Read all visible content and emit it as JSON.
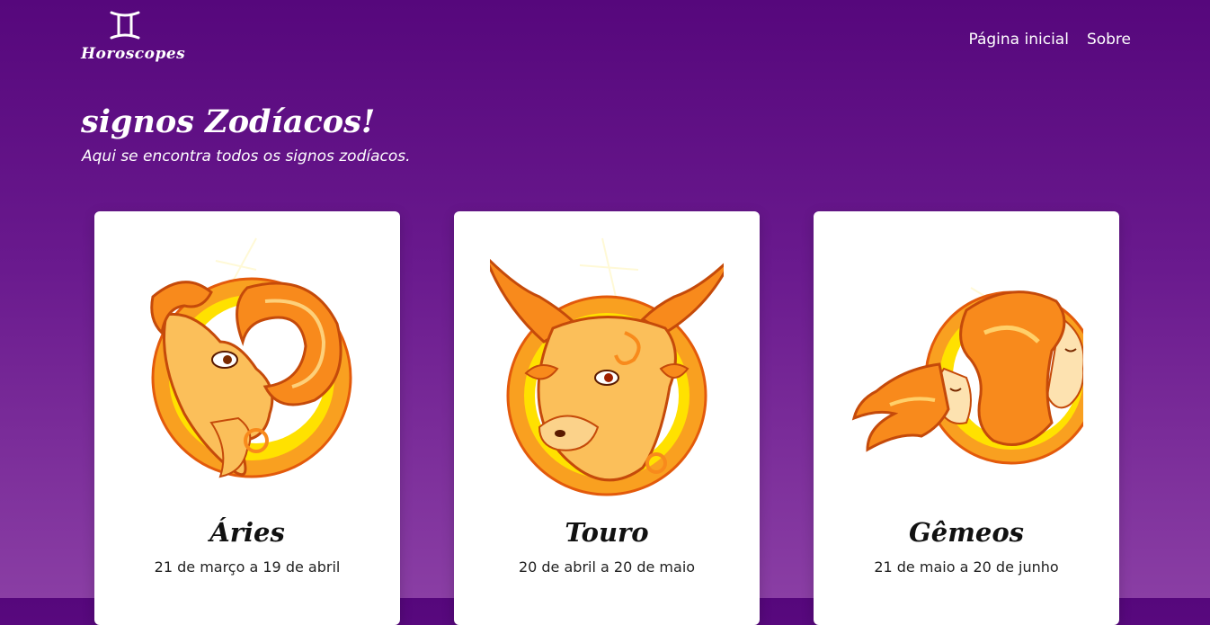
{
  "header": {
    "logo_text": "Horoscopes",
    "logo_icon": "gemini-glyph-icon",
    "nav": [
      {
        "label": "Página inicial"
      },
      {
        "label": "Sobre"
      }
    ]
  },
  "hero": {
    "title": "signos Zodíacos!",
    "subtitle": "Aqui se encontra todos os signos zodíacos."
  },
  "signs": [
    {
      "name": "Áries",
      "dates": "21 de março a 19 de abril",
      "icon": "aries-ram-icon"
    },
    {
      "name": "Touro",
      "dates": "20 de abril a 20 de maio",
      "icon": "taurus-bull-icon"
    },
    {
      "name": "Gêmeos",
      "dates": "21 de maio a 20 de junho",
      "icon": "gemini-twins-icon"
    }
  ],
  "colors": {
    "background_top": "#56077c",
    "background_bottom": "#8a3ea4",
    "card": "#ffffff",
    "illustration_orange": "#f7941d",
    "illustration_yellow": "#ffd400"
  }
}
